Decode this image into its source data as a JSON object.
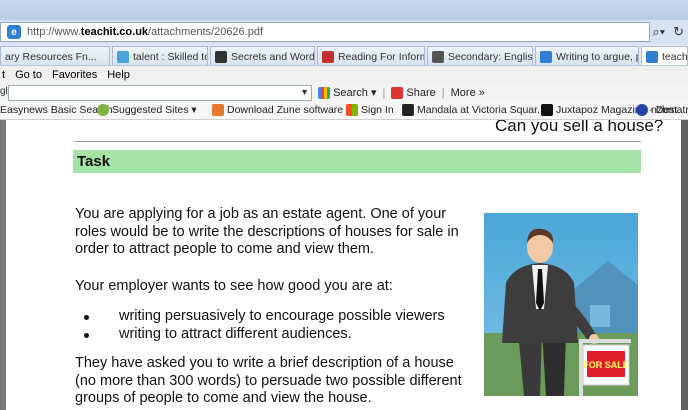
{
  "browser": {
    "url_prefix": "http://www.",
    "url_domain": "teachit.co.uk",
    "url_path": "/attachments/20626.pdf",
    "tabs": [
      {
        "label": "ary Resources Fn...",
        "active": false
      },
      {
        "label": "talent : Skilled to go -...",
        "active": false
      },
      {
        "label": "Secrets and Words - T...",
        "active": false
      },
      {
        "label": "Reading For Informati...",
        "active": false
      },
      {
        "label": "Secondary: English: K...",
        "active": false
      },
      {
        "label": "Writing to argue, pers...",
        "active": false
      },
      {
        "label": "teachit.co.u",
        "active": true
      }
    ],
    "menu": [
      "t",
      "Go to",
      "Favorites",
      "Help"
    ],
    "search_prefix": "gle",
    "search_buttons": {
      "search": "Search",
      "share": "Share",
      "more": "More »"
    },
    "favorites": [
      "Easynews Basic Search",
      "Suggested Sites ▾",
      "Download Zune software ...",
      "Sign In",
      "Mandala at Victoria Squar...",
      "Juxtapoz Magazine - Dest...",
      "nzbmatrix"
    ]
  },
  "document": {
    "heading": "Can you sell a house?",
    "task_label": "Task",
    "paragraph1": "You are applying for a job as an estate agent.  One of your roles would be to write the descriptions of houses for sale in order to attract people to come and view them.",
    "paragraph2": "Your employer wants to see how good you are at:",
    "bullets": [
      "writing persuasively to encourage possible viewers",
      "writing to attract different audiences."
    ],
    "paragraph3": "They have asked you to write a brief description of a house (no more than 300 words) to persuade two possible different groups of people to come and view the house.",
    "sign_text": "FOR SALE"
  },
  "colors": {
    "task_band": "#a6e3a6",
    "chrome": "#dbe6f3",
    "sign_red": "#e0202a"
  }
}
